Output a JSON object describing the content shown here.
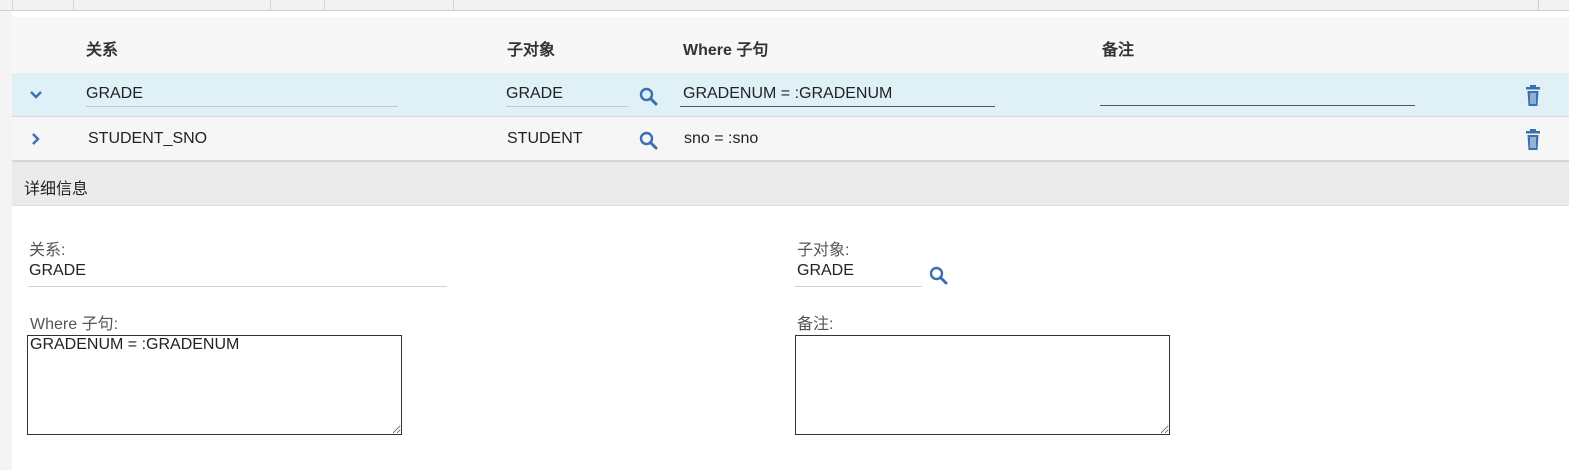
{
  "columns": {
    "relation": "关系",
    "child_object": "子对象",
    "where_clause": "Where 子句",
    "note": "备注"
  },
  "rows": [
    {
      "relation": "GRADE",
      "child_object": "GRADE",
      "where_clause": "GRADENUM = :GRADENUM",
      "note": "",
      "expanded": true
    },
    {
      "relation": "STUDENT_SNO",
      "child_object": "STUDENT",
      "where_clause": "sno = :sno",
      "note": "",
      "expanded": false
    }
  ],
  "details": {
    "title": "详细信息",
    "relation_label": "关系:",
    "relation_value": "GRADE",
    "child_object_label": "子对象:",
    "child_object_value": "GRADE",
    "where_label": "Where 子句:",
    "where_value": "GRADENUM = :GRADENUM",
    "note_label": "备注:",
    "note_value": ""
  },
  "colors": {
    "accent": "#3a6fb0",
    "selected_row": "#dff0f7"
  },
  "icons": {
    "search": "search-icon",
    "delete": "trash-icon",
    "expanded": "chevron-down-icon",
    "collapsed": "chevron-right-icon"
  }
}
